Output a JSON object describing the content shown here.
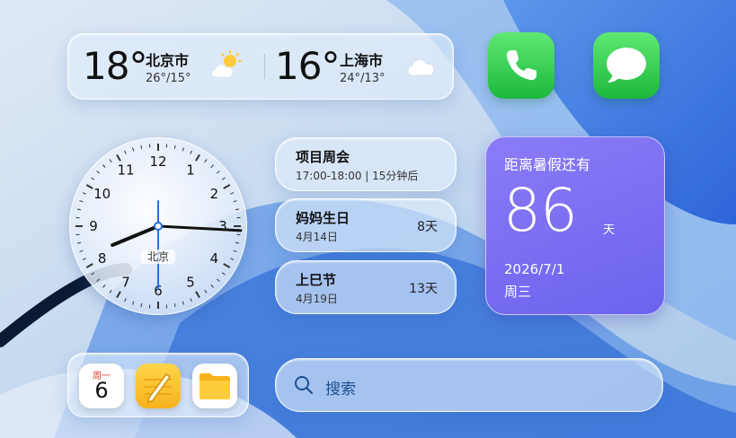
{
  "weather": [
    {
      "temp": "18°",
      "city": "北京市",
      "range": "26°/15°",
      "icon": "partly-sunny-icon"
    },
    {
      "temp": "16°",
      "city": "上海市",
      "range": "24°/13°",
      "icon": "cloudy-icon"
    }
  ],
  "apps": {
    "phone": {
      "icon": "phone-icon"
    },
    "messages": {
      "icon": "message-bubble-icon"
    }
  },
  "clock": {
    "city": "北京",
    "numerals": [
      "12",
      "1",
      "2",
      "3",
      "4",
      "5",
      "6",
      "7",
      "8",
      "9",
      "10",
      "11"
    ],
    "time": {
      "hour": 8,
      "minute": 15,
      "second": 30
    }
  },
  "events": [
    {
      "title": "项目周会",
      "subtitle": "17:00-18:00 | 15分钟后",
      "right": ""
    },
    {
      "title": "妈妈生日",
      "subtitle": "4月14日",
      "right": "8天"
    },
    {
      "title": "上巳节",
      "subtitle": "4月19日",
      "right": "13天"
    }
  ],
  "countdown": {
    "title": "距离暑假还有",
    "number": "86",
    "unit": "天",
    "date": "2026/7/1",
    "weekday": "周三",
    "color": "#7b6ff4"
  },
  "dock": {
    "calendar": {
      "weekday": "周一",
      "day": "6"
    },
    "notes": {
      "icon": "notes-pencil-icon"
    },
    "files": {
      "icon": "folder-icon"
    }
  },
  "search": {
    "label": "搜索",
    "icon": "search-icon"
  }
}
